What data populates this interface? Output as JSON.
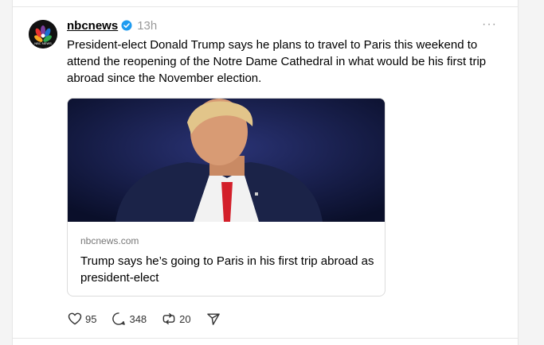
{
  "post": {
    "username": "nbcnews",
    "time": "13h",
    "more_label": "···",
    "text": "President-elect Donald Trump says he plans to travel to Paris this weekend to attend the reopening of the Notre Dame Cathedral in what would be his first trip abroad since the November election.",
    "avatar_text": "NBC NEWS",
    "link_card": {
      "domain": "nbcnews.com",
      "title": "Trump says he’s going to Paris in his first trip abroad as president-elect"
    },
    "actions": {
      "likes": "95",
      "replies": "348",
      "reposts": "20"
    }
  },
  "icons": {
    "verified": "verified-badge-icon",
    "like": "heart-icon",
    "reply": "comment-icon",
    "repost": "repost-icon",
    "share": "send-icon",
    "more": "more-options-icon"
  },
  "colors": {
    "verified": "#1d9bf0",
    "muted": "#999999",
    "border": "#dcdcdc"
  }
}
